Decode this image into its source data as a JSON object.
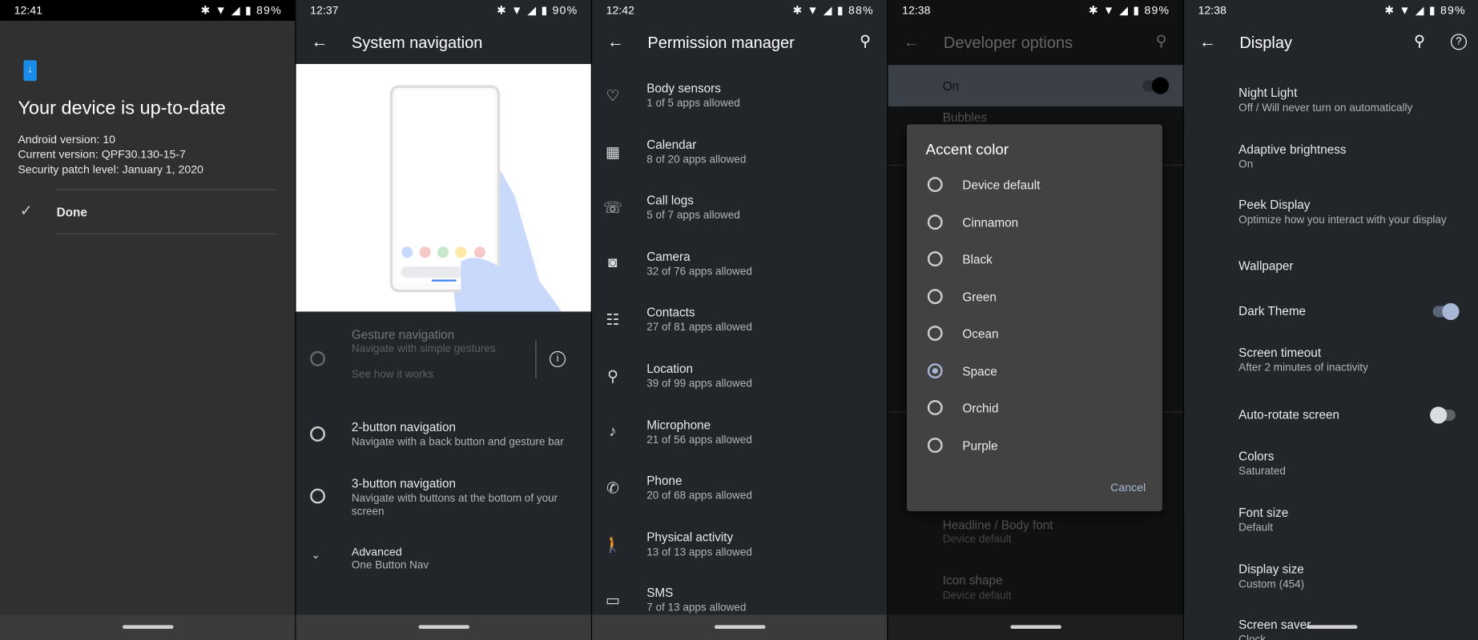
{
  "panels": {
    "update": {
      "time": "12:41",
      "battery": "89%",
      "title": "Your device is up-to-date",
      "info": [
        "Android version: 10",
        "Current version: QPF30.130-15-7",
        "Security patch level: January 1, 2020"
      ],
      "done": "Done"
    },
    "nav": {
      "time": "12:37",
      "battery": "90%",
      "title": "System navigation",
      "gesture": {
        "title": "Gesture navigation",
        "sub": "Navigate with simple gestures",
        "link": "See how it works"
      },
      "two": {
        "title": "2-button navigation",
        "sub": "Navigate with a back button and gesture bar"
      },
      "three": {
        "title": "3-button navigation",
        "sub": "Navigate with buttons at the bottom of your",
        "sub2": "screen"
      },
      "advanced": {
        "title": "Advanced",
        "sub": "One Button Nav"
      }
    },
    "perm": {
      "time": "12:42",
      "battery": "88%",
      "title": "Permission manager",
      "items": [
        {
          "icon": "heart-icon",
          "glyph": "♡",
          "title": "Body sensors",
          "sub": "1 of 5 apps allowed"
        },
        {
          "icon": "calendar-icon",
          "glyph": "▦",
          "title": "Calendar",
          "sub": "8 of 20 apps allowed"
        },
        {
          "icon": "call-log-icon",
          "glyph": "☏",
          "title": "Call logs",
          "sub": "5 of 7 apps allowed"
        },
        {
          "icon": "camera-icon",
          "glyph": "◙",
          "title": "Camera",
          "sub": "32 of 76 apps allowed"
        },
        {
          "icon": "contacts-icon",
          "glyph": "☷",
          "title": "Contacts",
          "sub": "27 of 81 apps allowed"
        },
        {
          "icon": "location-icon",
          "glyph": "⚲",
          "title": "Location",
          "sub": "39 of 99 apps allowed"
        },
        {
          "icon": "microphone-icon",
          "glyph": "♪",
          "title": "Microphone",
          "sub": "21 of 56 apps allowed"
        },
        {
          "icon": "phone-icon",
          "glyph": "✆",
          "title": "Phone",
          "sub": "20 of 68 apps allowed"
        },
        {
          "icon": "walk-icon",
          "glyph": "🚶",
          "title": "Physical activity",
          "sub": "13 of 13 apps allowed"
        },
        {
          "icon": "sms-icon",
          "glyph": "▭",
          "title": "SMS",
          "sub": "7 of 13 apps allowed"
        }
      ]
    },
    "dev": {
      "time": "12:38",
      "battery": "89%",
      "title": "Developer options",
      "on": "On",
      "bubbles": "Bubbles",
      "dialog": {
        "title": "Accent color",
        "options": [
          "Device default",
          "Cinnamon",
          "Black",
          "Green",
          "Ocean",
          "Space",
          "Orchid",
          "Purple"
        ],
        "selected": "Space",
        "cancel": "Cancel"
      },
      "bg_items": [
        {
          "title": "Headline / Body font",
          "sub": "Device default"
        },
        {
          "title": "Icon shape",
          "sub": "Device default"
        }
      ]
    },
    "display": {
      "time": "12:38",
      "battery": "89%",
      "title": "Display",
      "items": [
        {
          "title": "Night Light",
          "sub": "Off / Will never turn on automatically"
        },
        {
          "title": "Adaptive brightness",
          "sub": "On"
        },
        {
          "title": "Peek Display",
          "sub": "Optimize how you interact with your display"
        },
        {
          "title": "Wallpaper"
        },
        {
          "title": "Dark Theme",
          "toggle": true
        },
        {
          "title": "Screen timeout",
          "sub": "After 2 minutes of inactivity"
        },
        {
          "title": "Auto-rotate screen",
          "toggle": false
        },
        {
          "title": "Colors",
          "sub": "Saturated"
        },
        {
          "title": "Font size",
          "sub": "Default"
        },
        {
          "title": "Display size",
          "sub": "Custom (454)"
        },
        {
          "title": "Screen saver",
          "sub": "Clock"
        }
      ]
    }
  },
  "status_icons": "✱ ▼ ◢ ▮",
  "colors": {
    "accent": "#a9b7d6",
    "update_icon": "#1a8be6",
    "dialog": "#424242"
  }
}
